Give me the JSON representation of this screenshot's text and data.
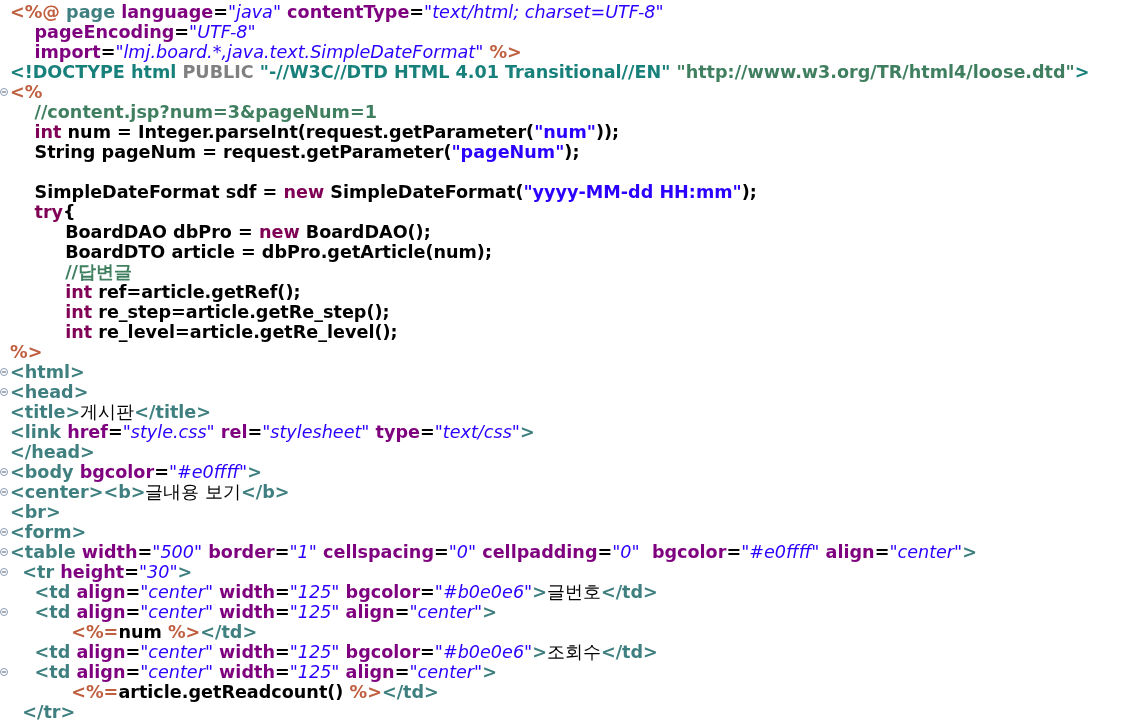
{
  "editor": {
    "lines": [
      {
        "foldable": false,
        "tokens": [
          {
            "kind": "delim",
            "text": "<%@"
          },
          {
            "kind": "tag",
            "text": " page"
          },
          {
            "kind": "attr",
            "text": " language"
          },
          {
            "kind": "plain",
            "text": "="
          },
          {
            "kind": "value",
            "text": "\"java\""
          },
          {
            "kind": "attr",
            "text": " contentType"
          },
          {
            "kind": "plain",
            "text": "="
          },
          {
            "kind": "value",
            "text": "\"text/html; charset=UTF-8\""
          }
        ]
      },
      {
        "foldable": false,
        "tokens": [
          {
            "kind": "attr",
            "text": "    pageEncoding"
          },
          {
            "kind": "plain",
            "text": "="
          },
          {
            "kind": "value",
            "text": "\"UTF-8\""
          }
        ]
      },
      {
        "foldable": false,
        "tokens": [
          {
            "kind": "attr",
            "text": "    import"
          },
          {
            "kind": "plain",
            "text": "="
          },
          {
            "kind": "value",
            "text": "\"lmj.board.*,java.text.SimpleDateFormat\""
          },
          {
            "kind": "delim",
            "text": " %>"
          }
        ]
      },
      {
        "foldable": false,
        "tokens": [
          {
            "kind": "doctype",
            "text": "<!DOCTYPE html"
          },
          {
            "kind": "keyword_grey",
            "text": " PUBLIC"
          },
          {
            "kind": "doctype",
            "text": " \"-//W3C//DTD HTML 4.01 Transitional//EN\""
          },
          {
            "kind": "doctype_url",
            "text": " \"http://www.w3.org/TR/html4/loose.dtd\""
          },
          {
            "kind": "doctype",
            "text": ">"
          }
        ]
      },
      {
        "foldable": true,
        "tokens": [
          {
            "kind": "delim",
            "text": "<%"
          }
        ]
      },
      {
        "foldable": false,
        "tokens": [
          {
            "kind": "comment",
            "text": "    //content.jsp?num=3&pageNum=1"
          }
        ]
      },
      {
        "foldable": false,
        "tokens": [
          {
            "kind": "keyword",
            "text": "    int"
          },
          {
            "kind": "plain",
            "text": " num = Integer.parseInt(request.getParameter("
          },
          {
            "kind": "string",
            "text": "\"num\""
          },
          {
            "kind": "plain",
            "text": "));"
          }
        ]
      },
      {
        "foldable": false,
        "tokens": [
          {
            "kind": "plain",
            "text": "    String pageNum = request.getParameter("
          },
          {
            "kind": "string",
            "text": "\"pageNum\""
          },
          {
            "kind": "plain",
            "text": ");"
          }
        ]
      },
      {
        "foldable": false
      },
      {
        "foldable": false,
        "tokens": [
          {
            "kind": "plain",
            "text": "    SimpleDateFormat sdf = "
          },
          {
            "kind": "keyword",
            "text": "new"
          },
          {
            "kind": "plain",
            "text": " SimpleDateFormat("
          },
          {
            "kind": "string",
            "text": "\"yyyy-MM-dd HH:mm\""
          },
          {
            "kind": "plain",
            "text": ");"
          }
        ]
      },
      {
        "foldable": false,
        "tokens": [
          {
            "kind": "keyword",
            "text": "    try"
          },
          {
            "kind": "plain",
            "text": "{"
          }
        ]
      },
      {
        "foldable": false,
        "tokens": [
          {
            "kind": "plain",
            "text": "         BoardDAO dbPro = "
          },
          {
            "kind": "keyword",
            "text": "new"
          },
          {
            "kind": "plain",
            "text": " BoardDAO();"
          }
        ]
      },
      {
        "foldable": false,
        "tokens": [
          {
            "kind": "plain",
            "text": "         BoardDTO article = dbPro.getArticle(num);"
          }
        ]
      },
      {
        "foldable": false,
        "tokens": [
          {
            "kind": "comment",
            "text": "         //답변글"
          }
        ]
      },
      {
        "foldable": false,
        "tokens": [
          {
            "kind": "keyword",
            "text": "         int"
          },
          {
            "kind": "plain",
            "text": " ref=article.getRef();"
          }
        ]
      },
      {
        "foldable": false,
        "tokens": [
          {
            "kind": "keyword",
            "text": "         int"
          },
          {
            "kind": "plain",
            "text": " re_step=article.getRe_step();"
          }
        ]
      },
      {
        "foldable": false,
        "tokens": [
          {
            "kind": "keyword",
            "text": "         int"
          },
          {
            "kind": "plain",
            "text": " re_level=article.getRe_level();"
          }
        ]
      },
      {
        "foldable": false,
        "tokens": [
          {
            "kind": "delim",
            "text": "%>"
          }
        ]
      },
      {
        "foldable": true,
        "tokens": [
          {
            "kind": "tag",
            "text": "<html>"
          }
        ]
      },
      {
        "foldable": true,
        "tokens": [
          {
            "kind": "tag",
            "text": "<head>"
          }
        ]
      },
      {
        "foldable": false,
        "tokens": [
          {
            "kind": "tag",
            "text": "<title>"
          },
          {
            "kind": "hangul",
            "text": "게시판"
          },
          {
            "kind": "tag",
            "text": "</title>"
          }
        ]
      },
      {
        "foldable": false,
        "tokens": [
          {
            "kind": "tag",
            "text": "<link"
          },
          {
            "kind": "attr",
            "text": " href"
          },
          {
            "kind": "plain",
            "text": "="
          },
          {
            "kind": "value",
            "text": "\"style.css\""
          },
          {
            "kind": "attr",
            "text": " rel"
          },
          {
            "kind": "plain",
            "text": "="
          },
          {
            "kind": "value",
            "text": "\"stylesheet\""
          },
          {
            "kind": "attr",
            "text": " type"
          },
          {
            "kind": "plain",
            "text": "="
          },
          {
            "kind": "value",
            "text": "\"text/css\""
          },
          {
            "kind": "tag",
            "text": ">"
          }
        ]
      },
      {
        "foldable": false,
        "tokens": [
          {
            "kind": "tag",
            "text": "</head>"
          }
        ]
      },
      {
        "foldable": true,
        "tokens": [
          {
            "kind": "tag",
            "text": "<body"
          },
          {
            "kind": "attr",
            "text": " bgcolor"
          },
          {
            "kind": "plain",
            "text": "="
          },
          {
            "kind": "value",
            "text": "\"#e0ffff\""
          },
          {
            "kind": "tag",
            "text": ">"
          }
        ]
      },
      {
        "foldable": true,
        "tokens": [
          {
            "kind": "tag",
            "text": "<center><b>"
          },
          {
            "kind": "hangul",
            "text": "글내용 보기"
          },
          {
            "kind": "tag",
            "text": "</b>"
          }
        ]
      },
      {
        "foldable": false,
        "tokens": [
          {
            "kind": "tag",
            "text": "<br>"
          }
        ]
      },
      {
        "foldable": true,
        "tokens": [
          {
            "kind": "tag",
            "text": "<form>"
          }
        ]
      },
      {
        "foldable": true,
        "tokens": [
          {
            "kind": "tag",
            "text": "<table"
          },
          {
            "kind": "attr",
            "text": " width"
          },
          {
            "kind": "plain",
            "text": "="
          },
          {
            "kind": "value",
            "text": "\"500\""
          },
          {
            "kind": "attr",
            "text": " border"
          },
          {
            "kind": "plain",
            "text": "="
          },
          {
            "kind": "value",
            "text": "\"1\""
          },
          {
            "kind": "attr",
            "text": " cellspacing"
          },
          {
            "kind": "plain",
            "text": "="
          },
          {
            "kind": "value",
            "text": "\"0\""
          },
          {
            "kind": "attr",
            "text": " cellpadding"
          },
          {
            "kind": "plain",
            "text": "="
          },
          {
            "kind": "value",
            "text": "\"0\""
          },
          {
            "kind": "attr",
            "text": "  bgcolor"
          },
          {
            "kind": "plain",
            "text": "="
          },
          {
            "kind": "value",
            "text": "\"#e0ffff\""
          },
          {
            "kind": "attr",
            "text": " align"
          },
          {
            "kind": "plain",
            "text": "="
          },
          {
            "kind": "value",
            "text": "\"center\""
          },
          {
            "kind": "tag",
            "text": ">"
          }
        ]
      },
      {
        "foldable": true,
        "tokens": [
          {
            "kind": "tag",
            "text": "  <tr"
          },
          {
            "kind": "attr",
            "text": " height"
          },
          {
            "kind": "plain",
            "text": "="
          },
          {
            "kind": "value",
            "text": "\"30\""
          },
          {
            "kind": "tag",
            "text": ">"
          }
        ]
      },
      {
        "foldable": false,
        "tokens": [
          {
            "kind": "tag",
            "text": "    <td"
          },
          {
            "kind": "attr",
            "text": " align"
          },
          {
            "kind": "plain",
            "text": "="
          },
          {
            "kind": "value",
            "text": "\"center\""
          },
          {
            "kind": "attr",
            "text": " width"
          },
          {
            "kind": "plain",
            "text": "="
          },
          {
            "kind": "value",
            "text": "\"125\""
          },
          {
            "kind": "attr",
            "text": " bgcolor"
          },
          {
            "kind": "plain",
            "text": "="
          },
          {
            "kind": "value",
            "text": "\"#b0e0e6\""
          },
          {
            "kind": "tag",
            "text": ">"
          },
          {
            "kind": "hangul",
            "text": "글번호"
          },
          {
            "kind": "tag",
            "text": "</td>"
          }
        ]
      },
      {
        "foldable": true,
        "tokens": [
          {
            "kind": "tag",
            "text": "    <td"
          },
          {
            "kind": "attr",
            "text": " align"
          },
          {
            "kind": "plain",
            "text": "="
          },
          {
            "kind": "value",
            "text": "\"center\""
          },
          {
            "kind": "attr",
            "text": " width"
          },
          {
            "kind": "plain",
            "text": "="
          },
          {
            "kind": "value",
            "text": "\"125\""
          },
          {
            "kind": "attr",
            "text": " align"
          },
          {
            "kind": "plain",
            "text": "="
          },
          {
            "kind": "value",
            "text": "\"center\""
          },
          {
            "kind": "tag",
            "text": ">"
          }
        ]
      },
      {
        "foldable": false,
        "tokens": [
          {
            "kind": "delim",
            "text": "          <%="
          },
          {
            "kind": "plain",
            "text": "num "
          },
          {
            "kind": "delim",
            "text": "%>"
          },
          {
            "kind": "tag",
            "text": "</td>"
          }
        ]
      },
      {
        "foldable": false,
        "tokens": [
          {
            "kind": "tag",
            "text": "    <td"
          },
          {
            "kind": "attr",
            "text": " align"
          },
          {
            "kind": "plain",
            "text": "="
          },
          {
            "kind": "value",
            "text": "\"center\""
          },
          {
            "kind": "attr",
            "text": " width"
          },
          {
            "kind": "plain",
            "text": "="
          },
          {
            "kind": "value",
            "text": "\"125\""
          },
          {
            "kind": "attr",
            "text": " bgcolor"
          },
          {
            "kind": "plain",
            "text": "="
          },
          {
            "kind": "value",
            "text": "\"#b0e0e6\""
          },
          {
            "kind": "tag",
            "text": ">"
          },
          {
            "kind": "hangul",
            "text": "조회수"
          },
          {
            "kind": "tag",
            "text": "</td>"
          }
        ]
      },
      {
        "foldable": true,
        "tokens": [
          {
            "kind": "tag",
            "text": "    <td"
          },
          {
            "kind": "attr",
            "text": " align"
          },
          {
            "kind": "plain",
            "text": "="
          },
          {
            "kind": "value",
            "text": "\"center\""
          },
          {
            "kind": "attr",
            "text": " width"
          },
          {
            "kind": "plain",
            "text": "="
          },
          {
            "kind": "value",
            "text": "\"125\""
          },
          {
            "kind": "attr",
            "text": " align"
          },
          {
            "kind": "plain",
            "text": "="
          },
          {
            "kind": "value",
            "text": "\"center\""
          },
          {
            "kind": "tag",
            "text": ">"
          }
        ]
      },
      {
        "foldable": false,
        "tokens": [
          {
            "kind": "delim",
            "text": "          <%="
          },
          {
            "kind": "plain",
            "text": "article.getReadcount() "
          },
          {
            "kind": "delim",
            "text": "%>"
          },
          {
            "kind": "tag",
            "text": "</td>"
          }
        ]
      },
      {
        "foldable": false,
        "tokens": [
          {
            "kind": "tag",
            "text": "  </tr>"
          }
        ]
      }
    ]
  }
}
